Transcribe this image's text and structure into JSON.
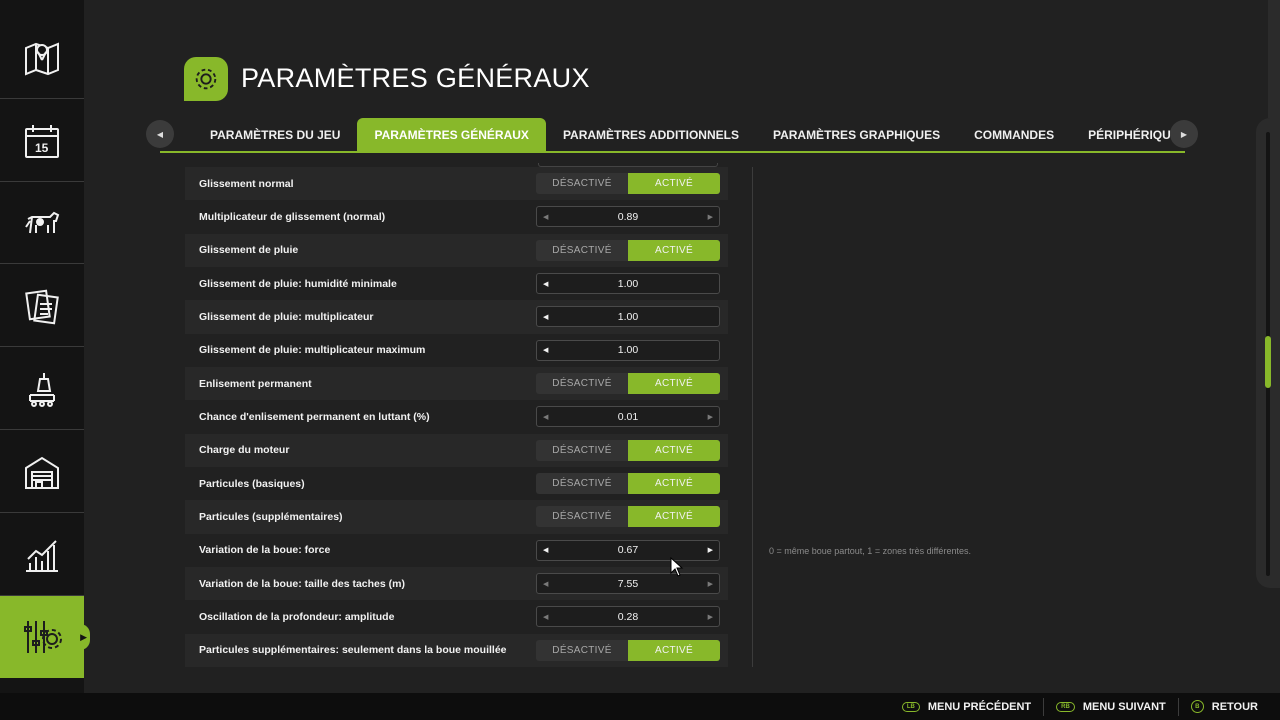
{
  "sidebar": {
    "items": [
      {
        "icon": "map-icon"
      },
      {
        "icon": "calendar-icon",
        "label": "15"
      },
      {
        "icon": "cow-icon"
      },
      {
        "icon": "contracts-icon"
      },
      {
        "icon": "production-icon"
      },
      {
        "icon": "shed-icon"
      },
      {
        "icon": "statistics-icon"
      },
      {
        "icon": "settings-icon",
        "active": true
      }
    ]
  },
  "header": {
    "title": "PARAMÈTRES GÉNÉRAUX",
    "icon": "gear-icon"
  },
  "tabs": [
    {
      "label": "PARAMÈTRES DU JEU"
    },
    {
      "label": "PARAMÈTRES GÉNÉRAUX",
      "active": true
    },
    {
      "label": "PARAMÈTRES ADDITIONNELS"
    },
    {
      "label": "PARAMÈTRES GRAPHIQUES"
    },
    {
      "label": "COMMANDES"
    },
    {
      "label": "PÉRIPHÉRIQUES"
    }
  ],
  "toggle_labels": {
    "off": "DÉSACTIVÉ",
    "on": "ACTIVÉ"
  },
  "settings": [
    {
      "label": "Glissement normal",
      "type": "toggle",
      "value": "ACTIVÉ"
    },
    {
      "label": "Multiplicateur de glissement (normal)",
      "type": "stepper",
      "value": "0.89"
    },
    {
      "label": "Glissement de pluie",
      "type": "toggle",
      "value": "ACTIVÉ"
    },
    {
      "label": "Glissement de pluie: humidité minimale",
      "type": "stepper",
      "value": "1.00"
    },
    {
      "label": "Glissement de pluie: multiplicateur",
      "type": "stepper",
      "value": "1.00"
    },
    {
      "label": "Glissement de pluie: multiplicateur maximum",
      "type": "stepper",
      "value": "1.00"
    },
    {
      "label": "Enlisement permanent",
      "type": "toggle",
      "value": "ACTIVÉ"
    },
    {
      "label": "Chance d'enlisement permanent en luttant (%)",
      "type": "stepper",
      "value": "0.01"
    },
    {
      "label": "Charge du moteur",
      "type": "toggle",
      "value": "ACTIVÉ"
    },
    {
      "label": "Particules (basiques)",
      "type": "toggle",
      "value": "ACTIVÉ"
    },
    {
      "label": "Particules (supplémentaires)",
      "type": "toggle",
      "value": "ACTIVÉ"
    },
    {
      "label": "Variation de la boue: force",
      "type": "stepper",
      "value": "0.67"
    },
    {
      "label": "Variation de la boue: taille des taches (m)",
      "type": "stepper",
      "value": "7.55"
    },
    {
      "label": "Oscillation de la profondeur: amplitude",
      "type": "stepper",
      "value": "0.28"
    },
    {
      "label": "Particules supplémentaires: seulement dans la boue mouillée",
      "type": "toggle",
      "value": "ACTIVÉ"
    }
  ],
  "description": "0 = même boue partout, 1 = zones très différentes.",
  "footer": [
    {
      "badge": "LB",
      "label": "MENU PRÉCÉDENT"
    },
    {
      "badge": "RB",
      "label": "MENU SUIVANT"
    },
    {
      "badge": "B",
      "label": "RETOUR"
    }
  ],
  "colors": {
    "accent": "#88b82a",
    "background": "#212121",
    "sidebar": "#141414"
  }
}
